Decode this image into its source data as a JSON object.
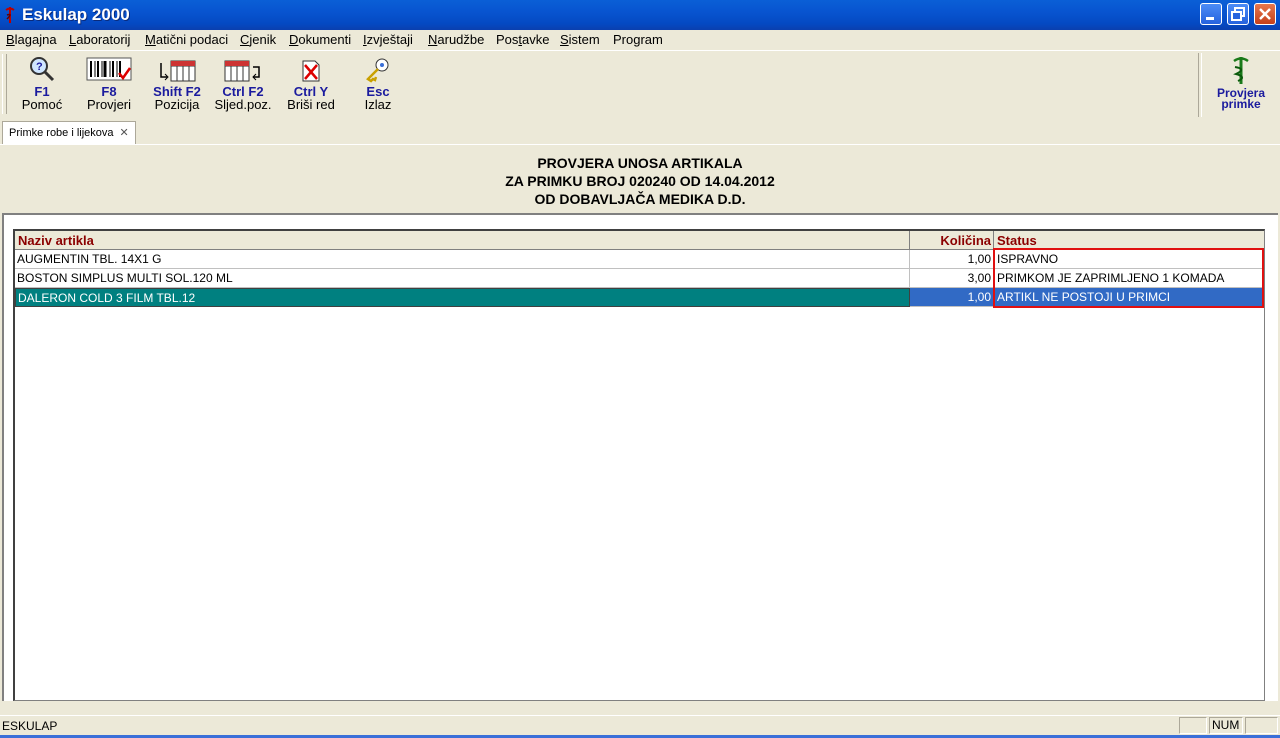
{
  "window": {
    "title": "Eskulap 2000"
  },
  "menu": [
    {
      "pre": "",
      "u": "B",
      "post": "lagajna"
    },
    {
      "pre": "",
      "u": "L",
      "post": "aboratorij"
    },
    {
      "pre": "",
      "u": "M",
      "post": "atični podaci"
    },
    {
      "pre": "",
      "u": "C",
      "post": "jenik"
    },
    {
      "pre": "",
      "u": "D",
      "post": "okumenti"
    },
    {
      "pre": "",
      "u": "I",
      "post": "zvještaji"
    },
    {
      "pre": "",
      "u": "N",
      "post": "arudžbe"
    },
    {
      "pre": "Pos",
      "u": "t",
      "post": "avke"
    },
    {
      "pre": "",
      "u": "S",
      "post": "istem"
    },
    {
      "pre": "Program",
      "u": "",
      "post": ""
    }
  ],
  "toolbar": {
    "buttons": [
      {
        "key": "F1",
        "label": "Pomoć",
        "icon": "magnifier-help-icon"
      },
      {
        "key": "F8",
        "label": "Provjeri",
        "icon": "barcode-check-icon"
      },
      {
        "key": "Shift F2",
        "label": "Pozicija",
        "icon": "grid-position-icon"
      },
      {
        "key": "Ctrl F2",
        "label": "Sljed.poz.",
        "icon": "grid-next-icon"
      },
      {
        "key": "Ctrl Y",
        "label": "Briši red",
        "icon": "delete-row-icon"
      },
      {
        "key": "Esc",
        "label": "Izlaz",
        "icon": "key-exit-icon"
      }
    ],
    "right_label_1": "Provjera",
    "right_label_2": "primke",
    "right_icon": "caduceus-icon"
  },
  "tab": {
    "label": "Primke robe i lijekova"
  },
  "header": {
    "line1": "PROVJERA UNOSA ARTIKALA",
    "line2": "ZA PRIMKU BROJ 020240 OD 14.04.2012",
    "line3": "OD DOBAVLJAČA MEDIKA D.D."
  },
  "grid": {
    "columns": {
      "name": "Naziv artikla",
      "qty": "Količina",
      "status": "Status"
    },
    "rows": [
      {
        "name": "AUGMENTIN TBL. 14X1 G",
        "qty": "1,00",
        "status": "ISPRAVNO",
        "selected": false
      },
      {
        "name": "BOSTON SIMPLUS MULTI SOL.120 ML",
        "qty": "3,00",
        "status": "PRIMKOM JE ZAPRIMLJENO 1 KOMADA",
        "selected": false
      },
      {
        "name": "DALERON COLD 3 FILM TBL.12",
        "qty": "1,00",
        "status": "ARTIKL NE POSTOJI U PRIMCI",
        "selected": true
      }
    ]
  },
  "statusbar": {
    "text": "ESKULAP",
    "num": "NUM"
  },
  "colors": {
    "header_text": "#8b0000",
    "selection": "#316ac5",
    "selection_name": "#008080",
    "highlight_box": "#e01010",
    "shortcut_text": "#1b1b9e"
  }
}
